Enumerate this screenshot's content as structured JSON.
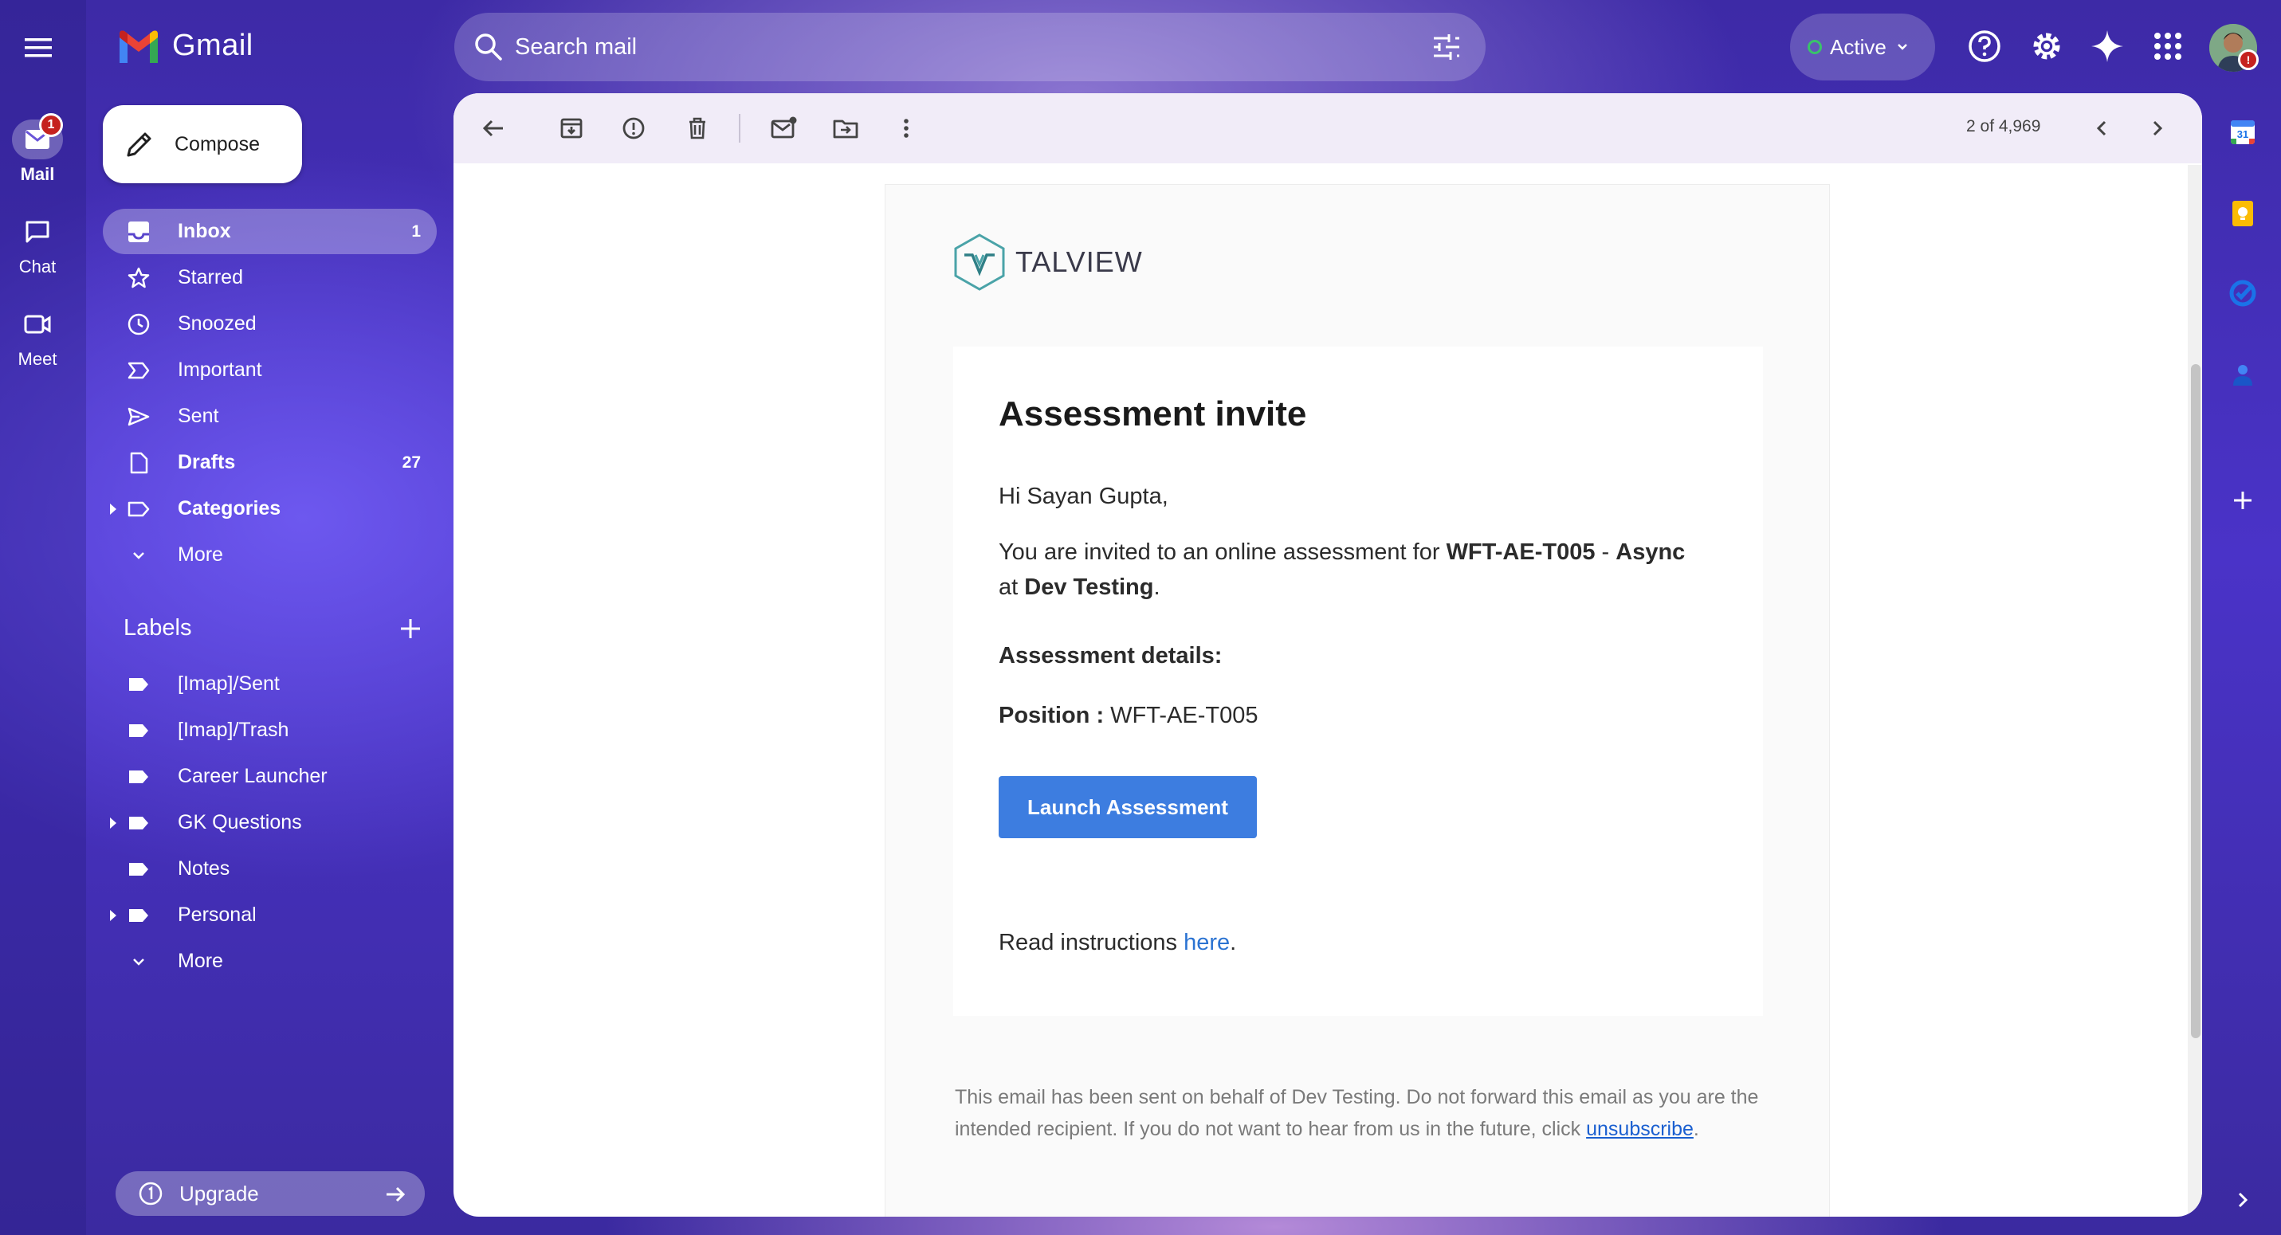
{
  "app": {
    "brand": "Gmail"
  },
  "rail": {
    "mail": "Mail",
    "mail_badge": "1",
    "chat": "Chat",
    "meet": "Meet"
  },
  "search": {
    "placeholder": "Search mail"
  },
  "status": {
    "label": "Active"
  },
  "account": {
    "badge": "!"
  },
  "compose": {
    "label": "Compose"
  },
  "nav": {
    "items": [
      {
        "label": "Inbox",
        "count": "1"
      },
      {
        "label": "Starred"
      },
      {
        "label": "Snoozed"
      },
      {
        "label": "Important"
      },
      {
        "label": "Sent"
      },
      {
        "label": "Drafts",
        "count": "27"
      },
      {
        "label": "Categories"
      },
      {
        "label": "More"
      }
    ]
  },
  "labels": {
    "heading": "Labels",
    "items": [
      "[Imap]/Sent",
      "[Imap]/Trash",
      "Career Launcher",
      "GK Questions",
      "Notes",
      "Personal",
      "More"
    ]
  },
  "upgrade": {
    "label": "Upgrade"
  },
  "toolbar": {
    "pager": "2 of 4,969"
  },
  "email": {
    "brand": "TALVIEW",
    "title": "Assessment invite",
    "greeting": "Hi Sayan Gupta,",
    "invite_pre": "You are invited to an online assessment for ",
    "invite_job": "WFT-AE-T005",
    "invite_sep": " - ",
    "invite_mode": "Async",
    "invite_at": "at ",
    "invite_company": "Dev Testing",
    "invite_end": ".",
    "details_heading": "Assessment details:",
    "position_label": "Position :",
    "position_value": " WFT-AE-T005",
    "button": "Launch Assessment",
    "read_pre": "Read instructions ",
    "read_link": "here",
    "read_end": ".",
    "footer": "This email has been sent on behalf of Dev Testing. Do not forward this email as you are the intended recipient. If you do not want to hear from us in the future, click ",
    "footer_link": "unsubscribe",
    "footer_end": "."
  },
  "side": {
    "calendar_day": "31"
  }
}
